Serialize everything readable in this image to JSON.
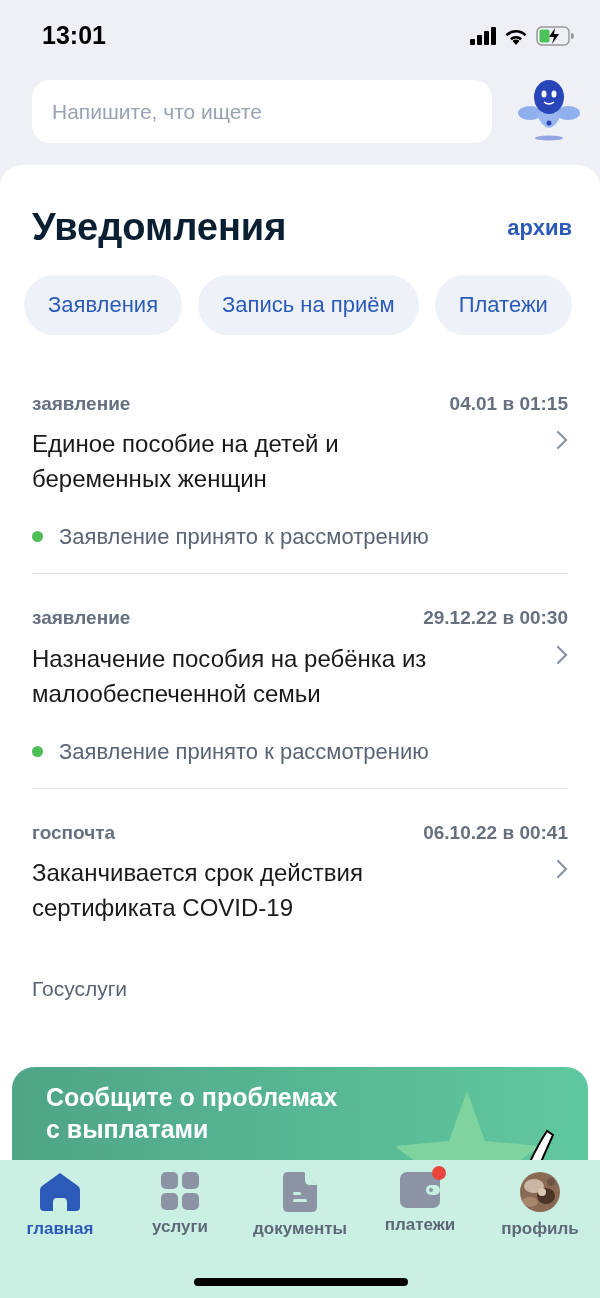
{
  "status_bar": {
    "time": "13:01"
  },
  "search": {
    "placeholder": "Напишите, что ищете"
  },
  "header": {
    "title": "Уведомления",
    "archive_link": "архив"
  },
  "filters": [
    {
      "label": "Заявления",
      "selected": false
    },
    {
      "label": "Запись на приём",
      "selected": false
    },
    {
      "label": "Платежи",
      "selected": false
    }
  ],
  "notifications": [
    {
      "type": "заявление",
      "date": "04.01 в 01:15",
      "title": "Единое пособие на детей и беременных женщин",
      "status": "Заявление принято к рассмотрению",
      "color": "#4cbf5a"
    },
    {
      "type": "заявление",
      "date": "29.12.22 в 00:30",
      "title": "Назначение пособия на ребёнка из малообеспеченной семьи",
      "status": "Заявление принято к рассмотрению",
      "color": "#4cbf5a"
    },
    {
      "type": "госпочта",
      "date": "06.10.22 в 00:41",
      "title": "Заканчивается срок действия сертификата COVID-19",
      "sender": "Госуслуги"
    }
  ],
  "banner": {
    "title": "Сообщите о проблемах с выплатами"
  },
  "tab_bar": [
    {
      "kind": "home",
      "label": "главная",
      "selected": true,
      "badge": false
    },
    {
      "kind": "services",
      "label": "услуги",
      "selected": false,
      "badge": false
    },
    {
      "kind": "documents",
      "label": "документы",
      "selected": false,
      "badge": false
    },
    {
      "kind": "payments",
      "label": "платежи",
      "selected": false,
      "badge": true
    },
    {
      "kind": "profile",
      "label": "профиль",
      "selected": false,
      "badge": false
    }
  ]
}
